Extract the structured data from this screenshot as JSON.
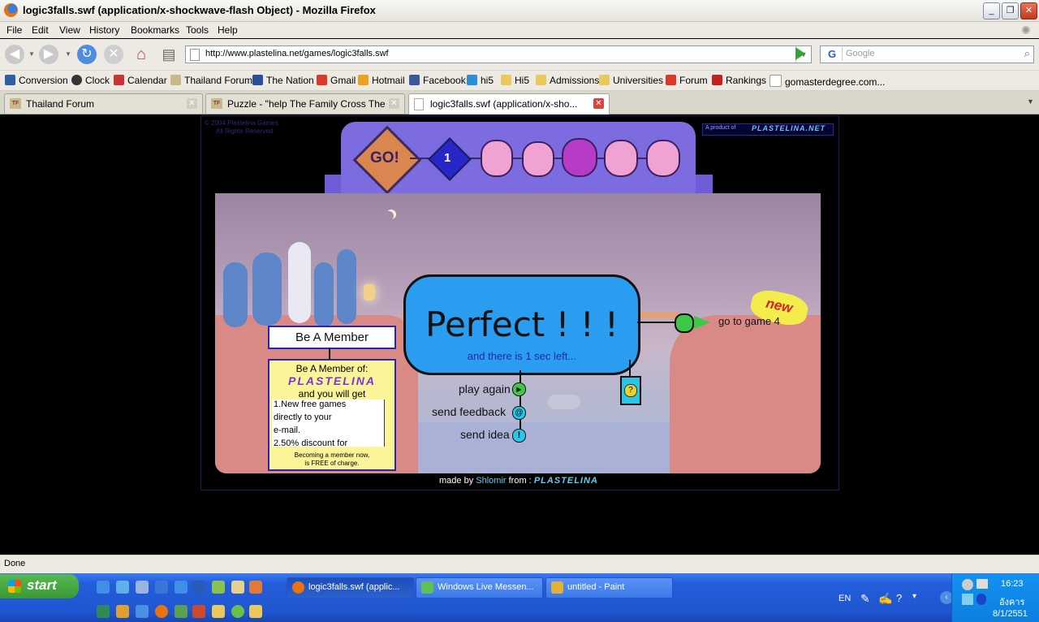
{
  "window": {
    "title": "logic3falls.swf (application/x-shockwave-flash Object) - Mozilla Firefox",
    "controls": [
      "_",
      "❐",
      "✕"
    ]
  },
  "menu": [
    "File",
    "Edit",
    "View",
    "History",
    "Bookmarks",
    "Tools",
    "Help"
  ],
  "nav": {
    "url": "http://www.plastelina.net/games/logic3falls.swf",
    "search_placeholder": "Google"
  },
  "bookmarks": [
    {
      "label": "Conversion",
      "icon": "xe-icon"
    },
    {
      "label": "Clock",
      "icon": "clock-icon"
    },
    {
      "label": "Calendar",
      "icon": "calendar-icon"
    },
    {
      "label": "Thailand Forum",
      "icon": "forum-icon"
    },
    {
      "label": "The Nation",
      "icon": "nation-icon"
    },
    {
      "label": "Gmail",
      "icon": "gmail-icon"
    },
    {
      "label": "Hotmail",
      "icon": "hotmail-icon"
    },
    {
      "label": "Facebook",
      "icon": "facebook-icon"
    },
    {
      "label": "hi5",
      "icon": "hi5-icon"
    },
    {
      "label": "Hi5",
      "icon": "folder-icon"
    },
    {
      "label": "Admissions",
      "icon": "folder-icon"
    },
    {
      "label": "Universities",
      "icon": "folder-icon"
    },
    {
      "label": "Forum",
      "icon": "gmail-icon"
    },
    {
      "label": "Rankings",
      "icon": "bw-icon"
    },
    {
      "label": "gomasterdegree.com...",
      "icon": "page-icon"
    }
  ],
  "tabs": [
    {
      "label": "Thailand Forum",
      "active": false
    },
    {
      "label": "Puzzle - \"help The Family Cross The Bri...",
      "active": false
    },
    {
      "label": "logic3falls.swf (application/x-sho...",
      "active": true
    }
  ],
  "game": {
    "copyright_line1": "© 2004 Plastelina Games",
    "copyright_line2": "All Rights Reserved",
    "go_label": "GO!",
    "level": "1",
    "product_of": "A product of",
    "brand": "PLASTELINA.NET",
    "result_title": "Perfect ! ! !",
    "result_sub": "and there is 1 sec left...",
    "play_again": "play again",
    "send_feedback": "send feedback",
    "send_idea": "send idea",
    "go_next": "go to game 4",
    "new_badge": "new",
    "member_button": "Be A Member",
    "member_heading": "Be A Member of:",
    "member_brand": "PLASTELINA",
    "member_sub": "and you will get",
    "member_list": [
      "1.New free games",
      "directly to your",
      "e-mail.",
      "2.50% discount for"
    ],
    "member_footer_1": "Becoming a member now,",
    "member_footer_2": "is FREE of charge.",
    "made_by": "made by",
    "author": "Shlomir",
    "from": "from :",
    "footer_brand": "PLASTELINA"
  },
  "status": "Done",
  "taskbar": {
    "start": "start",
    "items": [
      {
        "label": "logic3falls.swf (applic...",
        "active": true
      },
      {
        "label": "Windows Live Messen...",
        "active": false
      },
      {
        "label": "untitled - Paint",
        "active": false
      }
    ],
    "lang": "EN",
    "time": "16:23",
    "day": "อังคาร",
    "date": "8/1/2551"
  },
  "colors": {
    "stage_bg": "#b7a0b9",
    "panel_blue": "#2b9df0",
    "banner_purple": "#7d6be0",
    "cliff": "#d98a86"
  }
}
